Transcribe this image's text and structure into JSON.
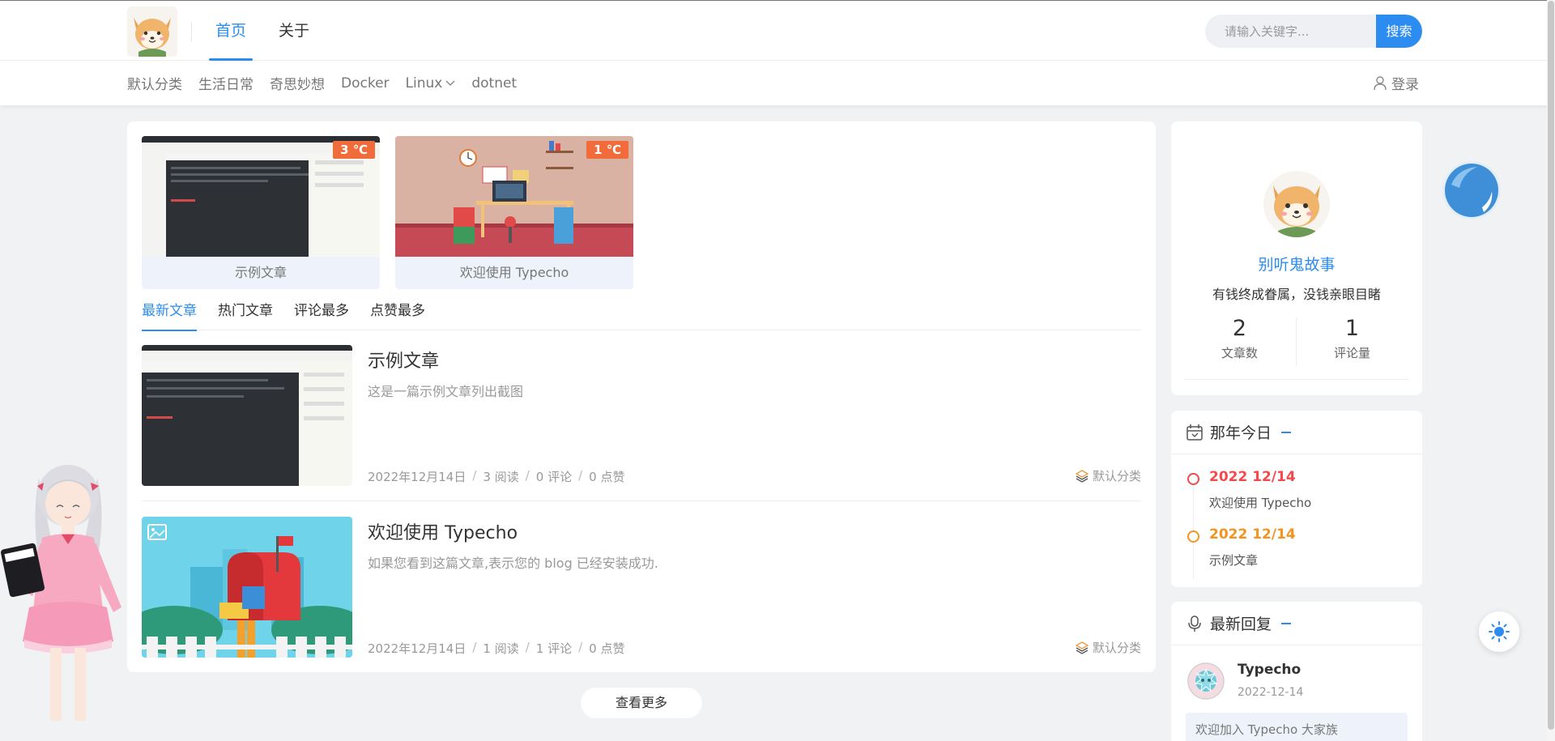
{
  "header": {
    "nav": [
      "首页",
      "关于"
    ],
    "search_placeholder": "请输入关键字...",
    "search_button": "搜索",
    "categories": [
      "默认分类",
      "生活日常",
      "奇思妙想",
      "Docker",
      "Linux",
      "dotnet"
    ],
    "login": "登录"
  },
  "featured": [
    {
      "title": "示例文章",
      "temp": "3 ℃"
    },
    {
      "title": "欢迎使用 Typecho",
      "temp": "1 ℃"
    }
  ],
  "tabs": [
    "最新文章",
    "热门文章",
    "评论最多",
    "点赞最多"
  ],
  "posts": [
    {
      "title": "示例文章",
      "excerpt": "这是一篇示例文章列出截图",
      "date": "2022年12月14日",
      "reads": "3 阅读",
      "comments": "0 评论",
      "likes": "0 点赞",
      "category": "默认分类"
    },
    {
      "title": "欢迎使用 Typecho",
      "excerpt": "如果您看到这篇文章,表示您的 blog 已经安装成功.",
      "date": "2022年12月14日",
      "reads": "1 阅读",
      "comments": "1 评论",
      "likes": "0 点赞",
      "category": "默认分类"
    }
  ],
  "more_button": "查看更多",
  "profile": {
    "name": "别听鬼故事",
    "motto": "有钱终成眷属，没钱亲眼目睹",
    "stats": [
      {
        "num": "2",
        "label": "文章数"
      },
      {
        "num": "1",
        "label": "评论量"
      }
    ]
  },
  "history": {
    "title": "那年今日",
    "items": [
      {
        "date": "2022 12/14",
        "title": "欢迎使用 Typecho",
        "color": "#f5484a"
      },
      {
        "date": "2022 12/14",
        "title": "示例文章",
        "color": "#f5931f"
      }
    ]
  },
  "replies": {
    "title": "最新回复",
    "items": [
      {
        "name": "Typecho",
        "date": "2022-12-14",
        "text": "欢迎加入 Typecho 大家族"
      }
    ]
  },
  "colors": {
    "accent": "#2d8cf0",
    "temp_badge": "#f16c3a"
  }
}
